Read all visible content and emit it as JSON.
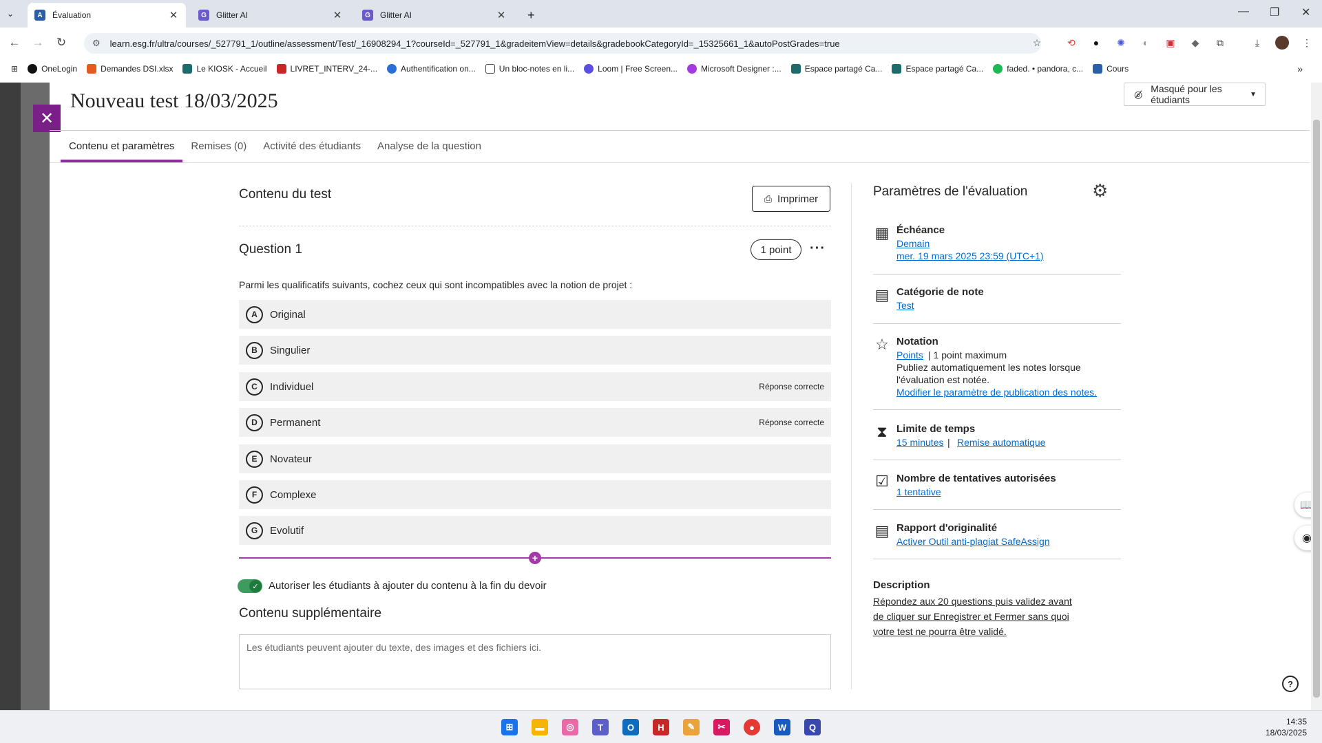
{
  "browser": {
    "tabs": [
      {
        "label": "Évaluation",
        "active": true
      },
      {
        "label": "Glitter AI",
        "active": false
      },
      {
        "label": "Glitter AI",
        "active": false
      }
    ],
    "url": "learn.esg.fr/ultra/courses/_527791_1/outline/assessment/Test/_16908294_1?courseId=_527791_1&gradeitemView=details&gradebookCategoryId=_15325661_1&autoPostGrades=true",
    "bookmarks": [
      "OneLogin",
      "Demandes DSI.xlsx",
      "Le KIOSK - Accueil",
      "LIVRET_INTERV_24-...",
      "Authentification on...",
      "Un bloc-notes en li...",
      "Loom | Free Screen...",
      "Microsoft Designer :...",
      "Espace partagé Ca...",
      "Espace partagé Ca...",
      "faded. • pandora, c...",
      "Cours"
    ]
  },
  "header": {
    "title": "Nouveau test 18/03/2025",
    "visibility": "Masqué pour les étudiants"
  },
  "tabs": [
    "Contenu et paramètres",
    "Remises (0)",
    "Activité des étudiants",
    "Analyse de la question"
  ],
  "content": {
    "title": "Contenu du test",
    "print": "Imprimer",
    "question": {
      "title": "Question 1",
      "points": "1 point",
      "text": "Parmi les qualificatifs suivants, cochez ceux qui sont incompatibles avec la notion de projet :",
      "answers": [
        {
          "letter": "A",
          "text": "Original",
          "correct": ""
        },
        {
          "letter": "B",
          "text": "Singulier",
          "correct": ""
        },
        {
          "letter": "C",
          "text": "Individuel",
          "correct": "Réponse correcte"
        },
        {
          "letter": "D",
          "text": "Permanent",
          "correct": "Réponse correcte"
        },
        {
          "letter": "E",
          "text": "Novateur",
          "correct": ""
        },
        {
          "letter": "F",
          "text": "Complexe",
          "correct": ""
        },
        {
          "letter": "G",
          "text": "Evolutif",
          "correct": ""
        }
      ]
    },
    "allow_label": "Autoriser les étudiants à ajouter du contenu à la fin du devoir",
    "extra_title": "Contenu supplémentaire",
    "extra_placeholder": "Les étudiants peuvent ajouter du texte, des images et des fichiers ici."
  },
  "settings": {
    "title": "Paramètres de l'évaluation",
    "due": {
      "h": "Échéance",
      "l1": "Demain",
      "l2": "mer. 19 mars 2025 23:59 (UTC+1)"
    },
    "category": {
      "h": "Catégorie de note",
      "l1": "Test"
    },
    "grading": {
      "h": "Notation",
      "link": "Points",
      "sep": " | 1 point maximum",
      "t1": "Publiez automatiquement les notes lorsque",
      "t2": "l'évaluation est notée.",
      "l2": "Modifier le paramètre de publication des notes."
    },
    "time": {
      "h": "Limite de temps",
      "l1": "15 minutes",
      "sep": " | ",
      "l2": "Remise automatique"
    },
    "attempts": {
      "h": "Nombre de tentatives autorisées",
      "l1": "1 tentative"
    },
    "originality": {
      "h": "Rapport d'originalité",
      "l1": "Activer Outil anti-plagiat SafeAssign"
    },
    "description": {
      "h": "Description",
      "lines": [
        "Répondez aux 20 questions puis validez avant",
        "de cliquer sur Enregistrer et Fermer sans quoi",
        "votre test ne pourra être validé."
      ]
    }
  },
  "taskbar": {
    "time": "14:35",
    "date": "18/03/2025"
  },
  "colors": {
    "accent": "#8c2f9e",
    "link": "#006dd6",
    "toggle": "#3e9b5f"
  }
}
